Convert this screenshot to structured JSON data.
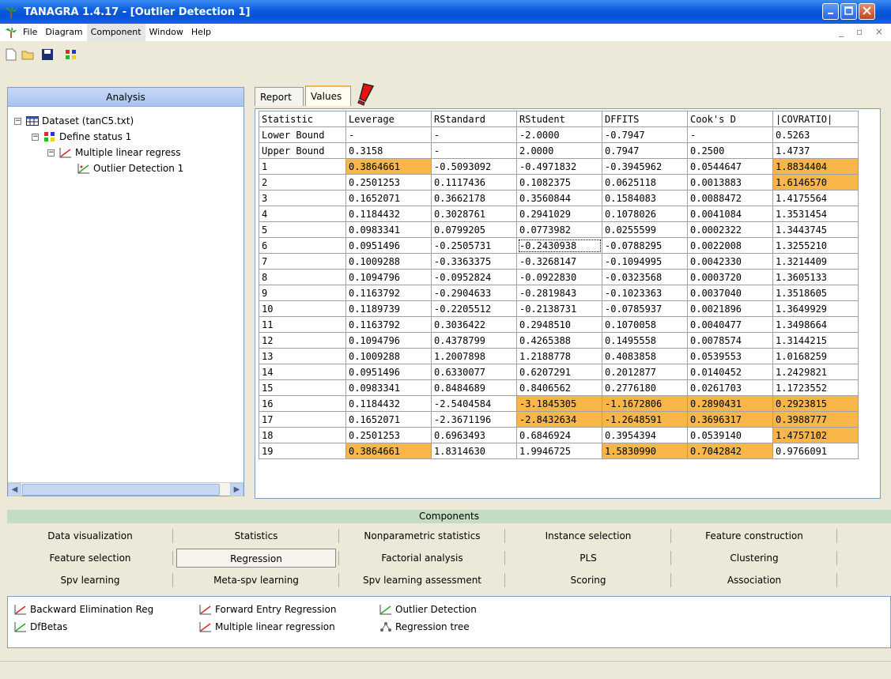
{
  "window": {
    "title": "TANAGRA 1.4.17 - [Outlier Detection 1]"
  },
  "menu": [
    "File",
    "Diagram",
    "Component",
    "Window",
    "Help"
  ],
  "analysis": {
    "header": "Analysis",
    "tree": [
      {
        "label": "Dataset (tanC5.txt)"
      },
      {
        "label": "Define status 1"
      },
      {
        "label": "Multiple linear regress"
      },
      {
        "label": "Outlier Detection 1"
      }
    ]
  },
  "tabs": [
    "Report",
    "Values"
  ],
  "table": {
    "columns": [
      "Statistic",
      "Leverage",
      "RStandard",
      "RStudent",
      "DFFITS",
      "Cook's D",
      "|COVRATIO|"
    ],
    "bounds": [
      [
        "Lower Bound",
        "-",
        "-",
        "-2.0000",
        "-0.7947",
        "-",
        "0.5263"
      ],
      [
        "Upper Bound",
        "0.3158",
        "-",
        "2.0000",
        "0.7947",
        "0.2500",
        "1.4737"
      ]
    ],
    "rows": [
      [
        "1",
        "0.3864661",
        "-0.5093092",
        "-0.4971832",
        "-0.3945962",
        "0.0544647",
        "1.8834404"
      ],
      [
        "2",
        "0.2501253",
        "0.1117436",
        "0.1082375",
        "0.0625118",
        "0.0013883",
        "1.6146570"
      ],
      [
        "3",
        "0.1652071",
        "0.3662178",
        "0.3560844",
        "0.1584083",
        "0.0088472",
        "1.4175564"
      ],
      [
        "4",
        "0.1184432",
        "0.3028761",
        "0.2941029",
        "0.1078026",
        "0.0041084",
        "1.3531454"
      ],
      [
        "5",
        "0.0983341",
        "0.0799205",
        "0.0773982",
        "0.0255599",
        "0.0002322",
        "1.3443745"
      ],
      [
        "6",
        "0.0951496",
        "-0.2505731",
        "-0.2430938",
        "-0.0788295",
        "0.0022008",
        "1.3255210"
      ],
      [
        "7",
        "0.1009288",
        "-0.3363375",
        "-0.3268147",
        "-0.1094995",
        "0.0042330",
        "1.3214409"
      ],
      [
        "8",
        "0.1094796",
        "-0.0952824",
        "-0.0922830",
        "-0.0323568",
        "0.0003720",
        "1.3605133"
      ],
      [
        "9",
        "0.1163792",
        "-0.2904633",
        "-0.2819843",
        "-0.1023363",
        "0.0037040",
        "1.3518605"
      ],
      [
        "10",
        "0.1189739",
        "-0.2205512",
        "-0.2138731",
        "-0.0785937",
        "0.0021896",
        "1.3649929"
      ],
      [
        "11",
        "0.1163792",
        "0.3036422",
        "0.2948510",
        "0.1070058",
        "0.0040477",
        "1.3498664"
      ],
      [
        "12",
        "0.1094796",
        "0.4378799",
        "0.4265388",
        "0.1495558",
        "0.0078574",
        "1.3144215"
      ],
      [
        "13",
        "0.1009288",
        "1.2007898",
        "1.2188778",
        "0.4083858",
        "0.0539553",
        "1.0168259"
      ],
      [
        "14",
        "0.0951496",
        "0.6330077",
        "0.6207291",
        "0.2012877",
        "0.0140452",
        "1.2429821"
      ],
      [
        "15",
        "0.0983341",
        "0.8484689",
        "0.8406562",
        "0.2776180",
        "0.0261703",
        "1.1723552"
      ],
      [
        "16",
        "0.1184432",
        "-2.5404584",
        "-3.1845305",
        "-1.1672806",
        "0.2890431",
        "0.2923815"
      ],
      [
        "17",
        "0.1652071",
        "-2.3671196",
        "-2.8432634",
        "-1.2648591",
        "0.3696317",
        "0.3988777"
      ],
      [
        "18",
        "0.2501253",
        "0.6963493",
        "0.6846924",
        "0.3954394",
        "0.0539140",
        "1.4757102"
      ],
      [
        "19",
        "0.3864661",
        "1.8314630",
        "1.9946725",
        "1.5830990",
        "0.7042842",
        "0.9766091"
      ]
    ],
    "highlighted": [
      [
        0,
        1
      ],
      [
        0,
        6
      ],
      [
        1,
        6
      ],
      [
        15,
        3
      ],
      [
        15,
        4
      ],
      [
        15,
        5
      ],
      [
        15,
        6
      ],
      [
        16,
        3
      ],
      [
        16,
        4
      ],
      [
        16,
        5
      ],
      [
        16,
        6
      ],
      [
        17,
        6
      ],
      [
        18,
        1
      ],
      [
        18,
        4
      ],
      [
        18,
        5
      ]
    ],
    "highlight_color": "#f8b648"
  },
  "components": {
    "header": "Components",
    "categories": [
      [
        "Data visualization",
        "Statistics",
        "Nonparametric statistics",
        "Instance selection",
        "Feature construction"
      ],
      [
        "Feature selection",
        "Regression",
        "Factorial analysis",
        "PLS",
        "Clustering"
      ],
      [
        "Spv learning",
        "Meta-spv learning",
        "Spv learning assessment",
        "Scoring",
        "Association"
      ]
    ],
    "selected": "Regression",
    "items": [
      "Backward Elimination Reg",
      "Forward Entry Regression",
      "Outlier Detection",
      "DfBetas",
      "Multiple linear regression",
      "Regression tree"
    ]
  }
}
